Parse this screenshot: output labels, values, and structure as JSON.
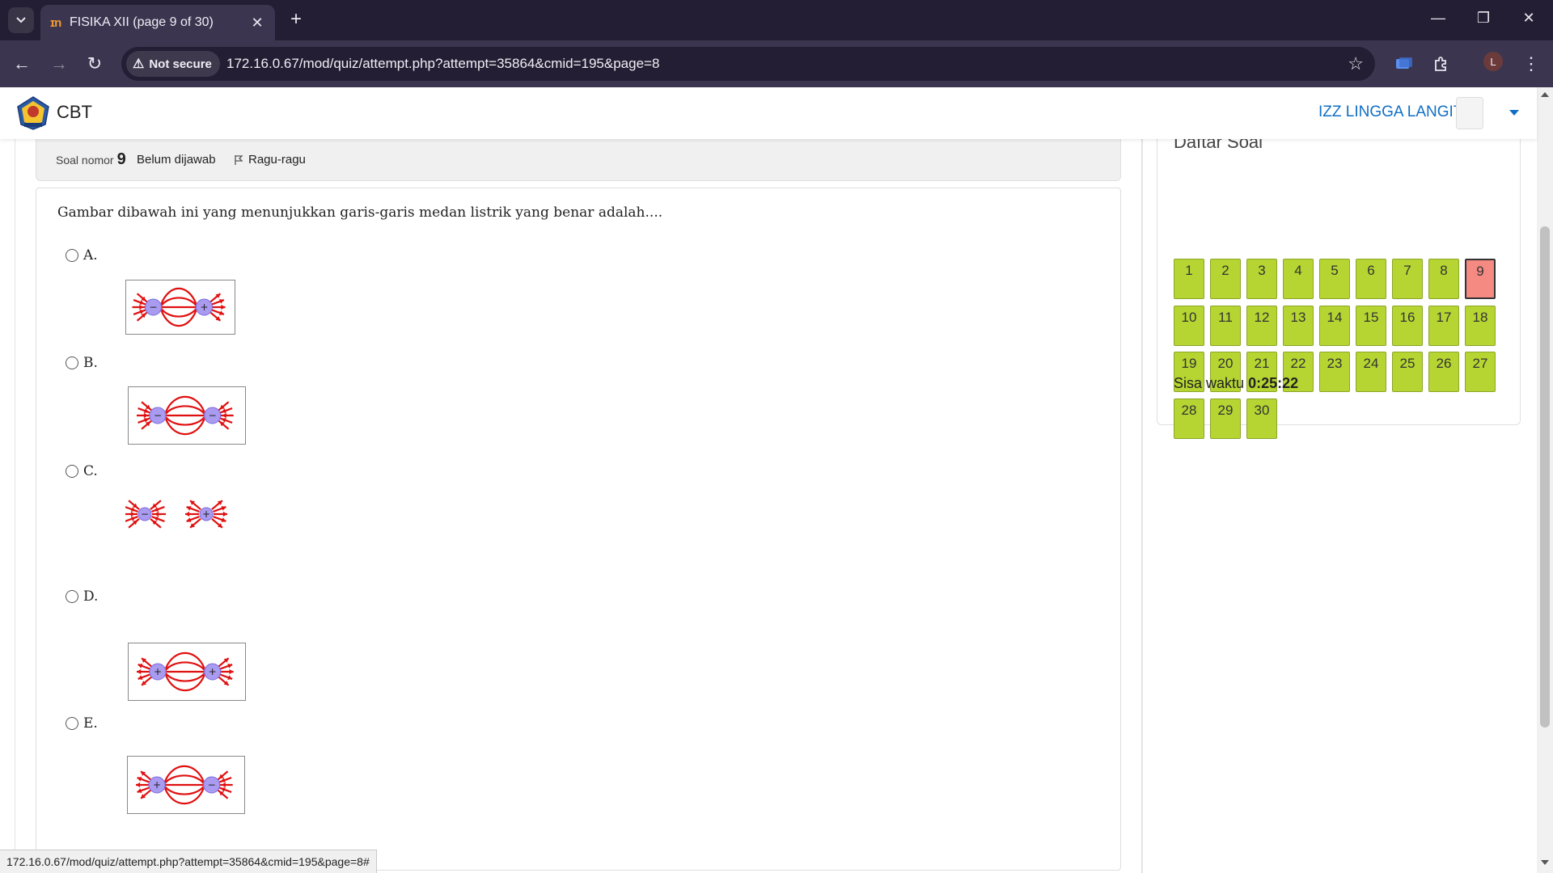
{
  "browser": {
    "tab_title": "FISIKA XII (page 9 of 30)",
    "tab_icon": "moodle-icon",
    "security_chip": "Not secure",
    "url": "172.16.0.67/mod/quiz/attempt.php?attempt=35864&cmid=195&page=8",
    "profile_initial": "L",
    "status_url": "172.16.0.67/mod/quiz/attempt.php?attempt=35864&cmid=195&page=8#"
  },
  "header": {
    "brand": "CBT",
    "user_name": "IZZ LINGGA LANGIT"
  },
  "question": {
    "number_label": "Soal nomor",
    "number": "9",
    "state": "Belum dijawab",
    "flag_label": "Ragu-ragu",
    "text": "Gambar dibawah ini yang menunjukkan garis-garis medan listrik yang benar adalah....",
    "options": [
      {
        "label": "A.",
        "charges": [
          "-",
          "+"
        ]
      },
      {
        "label": "B.",
        "charges": [
          "-",
          "-"
        ]
      },
      {
        "label": "C.",
        "charges": [
          "-",
          "+"
        ]
      },
      {
        "label": "D.",
        "charges": [
          "+",
          "+"
        ]
      },
      {
        "label": "E.",
        "charges": [
          "+",
          "-"
        ]
      }
    ]
  },
  "sidebar": {
    "title": "Daftar Soal",
    "questions": [
      "1",
      "2",
      "3",
      "4",
      "5",
      "6",
      "7",
      "8",
      "9",
      "10",
      "11",
      "12",
      "13",
      "14",
      "15",
      "16",
      "17",
      "18",
      "19",
      "20",
      "21",
      "22",
      "23",
      "24",
      "25",
      "26",
      "27",
      "28",
      "29",
      "30"
    ],
    "current": "9",
    "timer_label": "Sisa waktu",
    "timer_value": "0:25:22"
  },
  "colors": {
    "answered": "#b6d532",
    "current": "#f48a82",
    "field_line": "#e01010",
    "charge": "#a99bf0"
  }
}
